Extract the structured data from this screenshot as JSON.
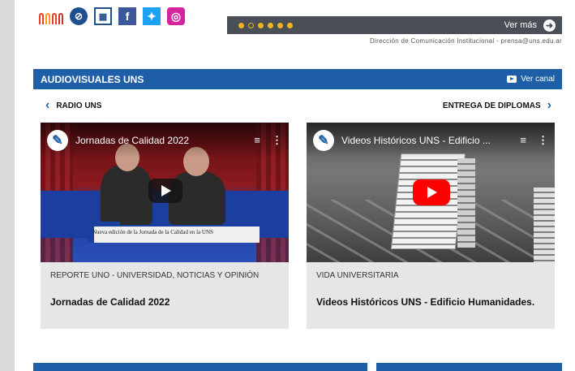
{
  "top": {
    "slider_dots": 6,
    "active_dot": 1,
    "ver_mas": "Ver más",
    "contact": "Dirección de Comunicación Institucional - prensa@uns.edu.ar"
  },
  "section": {
    "title": "AUDIOVISUALES UNS",
    "ver_canal": "Ver canal"
  },
  "nav": {
    "prev_label": "RADIO UNS",
    "next_label": "ENTREGA DE DIPLOMAS"
  },
  "cards": [
    {
      "video_title": "Jornadas de Calidad 2022",
      "lower_third": "Nueva edición de la Jornada de la Calidad en la UNS",
      "category": "REPORTE UNO - UNIVERSIDAD, NOTICIAS Y OPINIÓN",
      "title": "Jornadas de Calidad 2022"
    },
    {
      "video_title": "Videos Históricos UNS - Edificio ...",
      "category": "VIDA UNIVERSITARIA",
      "title": "Videos Históricos UNS - Edificio Humanidades."
    }
  ],
  "colors": {
    "accent_blue": "#1f5fa8",
    "slider_bg": "#4a4f55",
    "dot_color": "#f0b323",
    "youtube_red": "#ff0000"
  }
}
